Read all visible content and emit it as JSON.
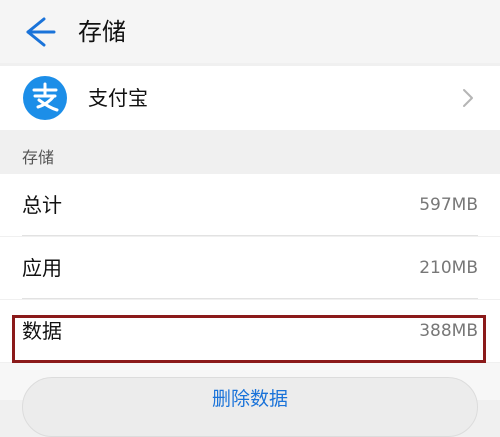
{
  "header": {
    "title": "存储",
    "back_icon": "arrow-left-icon"
  },
  "app": {
    "name": "支付宝",
    "icon": "alipay-icon",
    "chevron_icon": "chevron-right-icon"
  },
  "storage": {
    "section_label": "存储",
    "rows": [
      {
        "label": "总计",
        "value": "597MB"
      },
      {
        "label": "应用",
        "value": "210MB"
      },
      {
        "label": "数据",
        "value": "388MB"
      }
    ]
  },
  "actions": {
    "clear_data_label": "删除数据"
  },
  "colors": {
    "accent": "#1a73d9",
    "alipay_blue": "#1c8ee8",
    "highlight": "#8b1a1a"
  }
}
